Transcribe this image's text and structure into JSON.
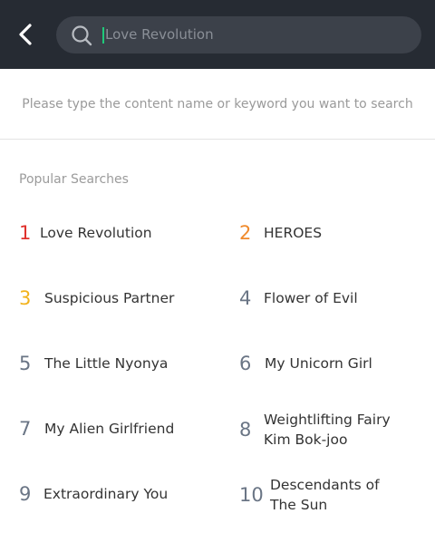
{
  "header": {
    "back_icon": "chevron-left-icon",
    "search_icon": "search-icon",
    "search_value": "Love Revolution",
    "caret_color": "#1fc97a"
  },
  "hint_text": "Please type the content name or keyword you want to search",
  "popular": {
    "title": "Popular Searches",
    "items": [
      {
        "rank": "1",
        "title": "Love Revolution",
        "rank_color": "#e0312c"
      },
      {
        "rank": "2",
        "title": "HEROES",
        "rank_color": "#f08a2c"
      },
      {
        "rank": "3",
        "title": "Suspicious Partner",
        "rank_color": "#f2b21b"
      },
      {
        "rank": "4",
        "title": "Flower of Evil",
        "rank_color": "#6a7585"
      },
      {
        "rank": "5",
        "title": "The Little Nyonya",
        "rank_color": "#6a7585"
      },
      {
        "rank": "6",
        "title": "My Unicorn Girl",
        "rank_color": "#6a7585"
      },
      {
        "rank": "7",
        "title": "My Alien Girlfriend",
        "rank_color": "#6a7585"
      },
      {
        "rank": "8",
        "title": "Weightlifting Fairy Kim Bok-joo",
        "rank_color": "#6a7585"
      },
      {
        "rank": "9",
        "title": "Extraordinary You",
        "rank_color": "#6a7585"
      },
      {
        "rank": "10",
        "title": "Descendants of The Sun",
        "rank_color": "#6a7585"
      }
    ]
  }
}
